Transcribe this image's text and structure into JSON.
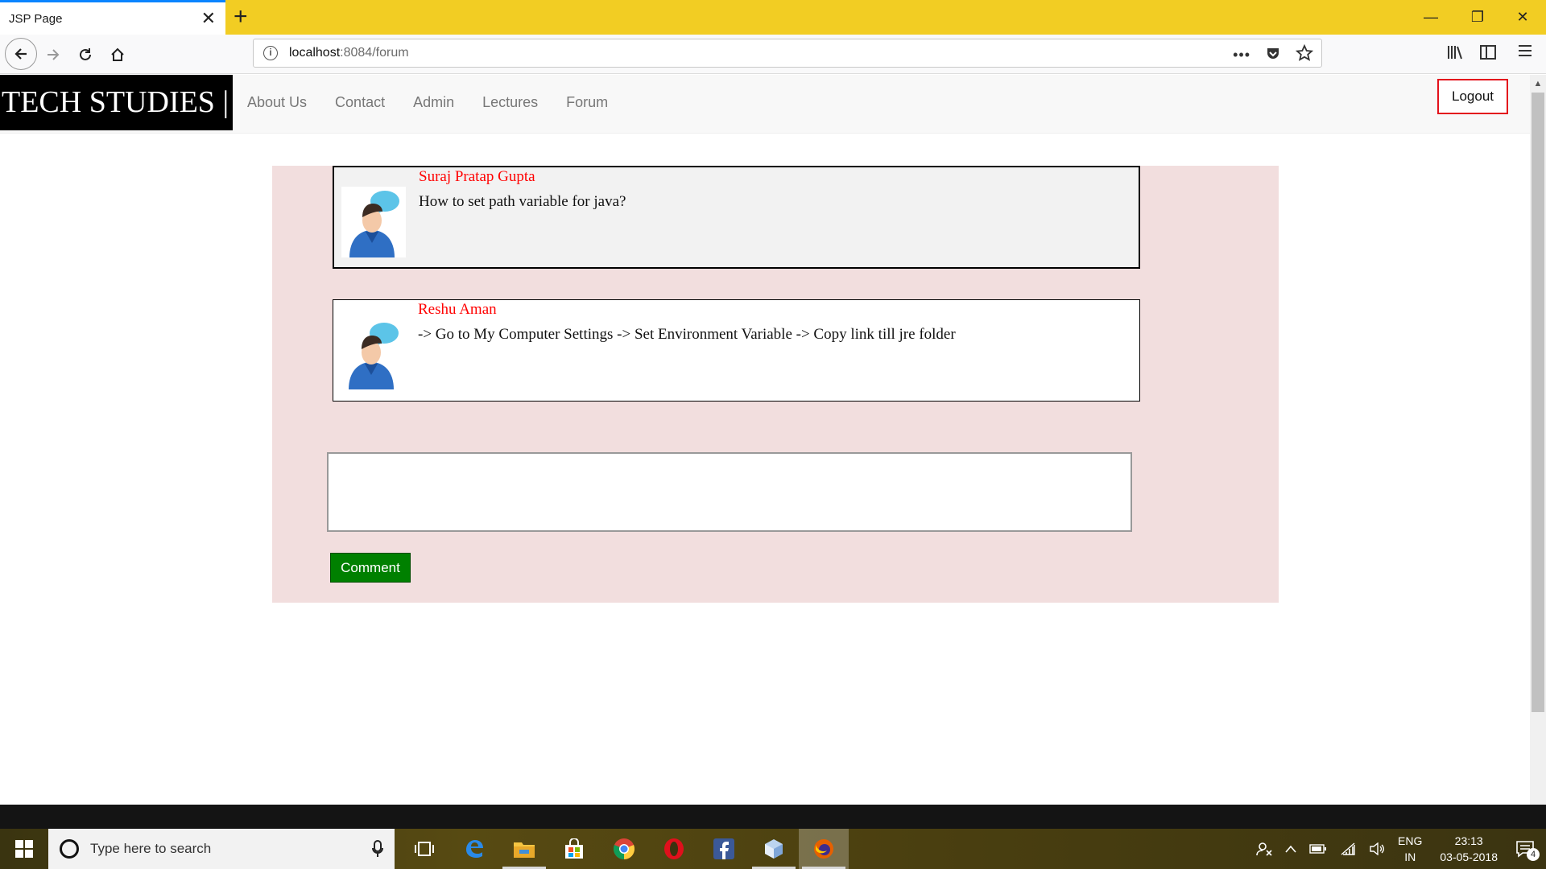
{
  "browser": {
    "tab_title": "JSP Page",
    "url_host": "localhost",
    "url_rest": ":8084/forum"
  },
  "site": {
    "brand": "TECH STUDIES |",
    "nav": [
      "About Us",
      "Contact",
      "Admin",
      "Lectures",
      "Forum"
    ],
    "logout_label": "Logout"
  },
  "forum": {
    "posts": [
      {
        "author": "Suraj Pratap Gupta",
        "message": "How to set path variable for java?"
      },
      {
        "author": "Reshu Aman",
        "message": "-> Go to My Computer Settings -> Set Environment Variable -> Copy link till jre folder"
      }
    ],
    "comment_value": "",
    "comment_button": "Comment"
  },
  "taskbar": {
    "search_placeholder": "Type here to search",
    "lang_top": "ENG",
    "lang_bottom": "IN",
    "time": "23:13",
    "date": "03-05-2018",
    "notifications": "4"
  },
  "colors": {
    "tabbar": "#f2cd23",
    "forum_bg": "#f2dede",
    "author": "#ff0000",
    "comment_button": "#008000",
    "logout_border": "#e3121c"
  }
}
